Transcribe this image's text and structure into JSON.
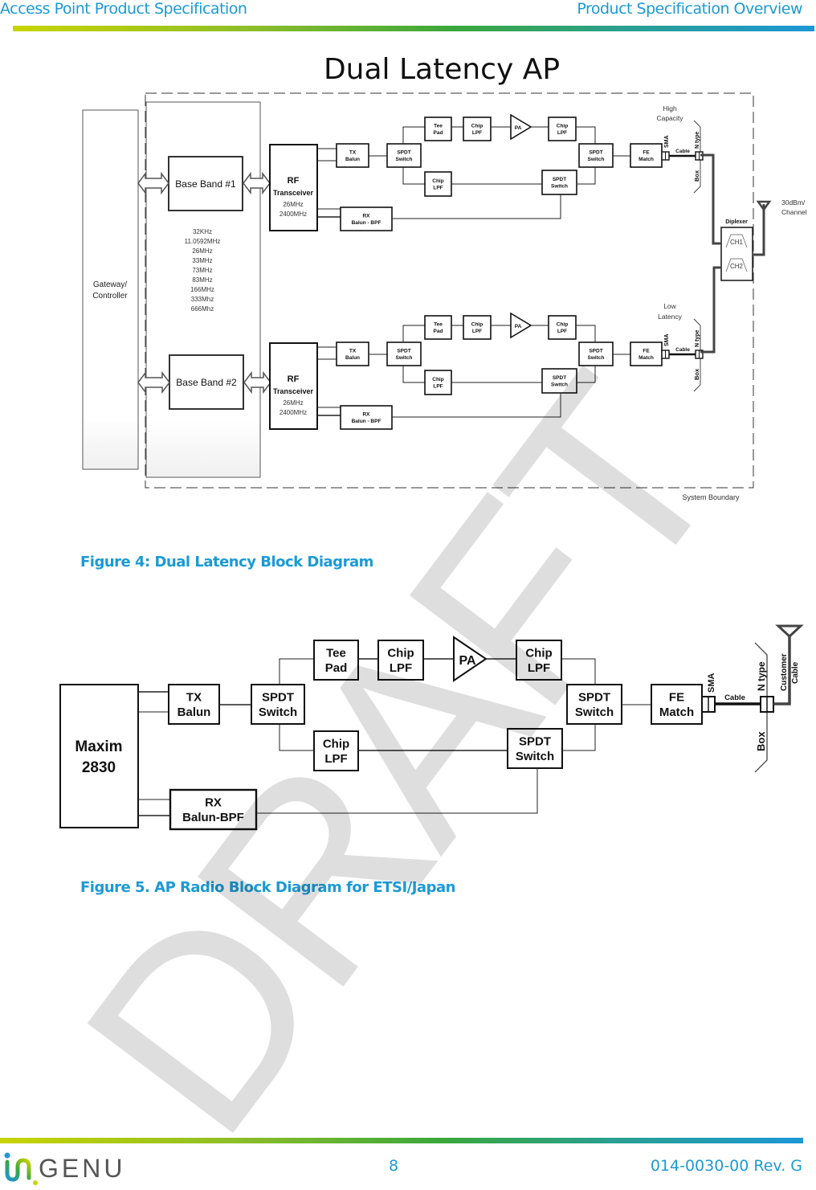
{
  "header": {
    "left_title": "Access Point Product Specification",
    "right_title": "Product Specification Overview",
    "colors": {
      "accent": "#1b9ad6",
      "rule_start": "#c8d400",
      "rule_end": "#1c97d6"
    }
  },
  "figure4": {
    "title": "Dual Latency AP",
    "caption": "Figure 4: Dual Latency Block Diagram",
    "gateway_label_line1": "Gateway/",
    "gateway_label_line2": "Controller",
    "baseband1": "Base Band #1",
    "baseband2": "Base Band #2",
    "clocks": [
      "32KHz",
      "11.0592MHz",
      "26MHz",
      "33MHz",
      "73MHz",
      "83MHz",
      "166MHz",
      "333Mhz",
      "666Mhz"
    ],
    "rf_title": "RF",
    "rf_subtitle": "Transceiver",
    "rf_freq1": "26MHz",
    "rf_freq2": "2400MHz",
    "tx_balun": [
      "TX",
      "Balun"
    ],
    "rx_balun": [
      "RX",
      "Balun -  BPF"
    ],
    "spdt": [
      "SPDT",
      "Switch"
    ],
    "tee_pad": [
      "Tee",
      "Pad"
    ],
    "chip_lpf": [
      "Chip",
      "LPF"
    ],
    "pa": "PA",
    "fe_match": [
      "FE",
      "Match"
    ],
    "sma": "SMA",
    "cable": "Cable",
    "ntype": "N type",
    "box": "Box",
    "path1_label": [
      "High",
      "Capacity"
    ],
    "path2_label": [
      "Low",
      "Latency"
    ],
    "diplexer": "Diplexer",
    "ch1": "CH1",
    "ch2": "CH2",
    "power_label": [
      "30dBm/",
      "Channel"
    ],
    "system_boundary": "System Boundary"
  },
  "figure5": {
    "caption": "Figure 5. AP Radio Block Diagram for ETSI/Japan",
    "maxim": [
      "Maxim",
      "2830"
    ],
    "tx_balun": [
      "TX",
      "Balun"
    ],
    "rx_balun": [
      "RX",
      "Balun-BPF"
    ],
    "spdt": [
      "SPDT",
      "Switch"
    ],
    "tee_pad": [
      "Tee",
      "Pad"
    ],
    "chip_lpf": [
      "Chip",
      "LPF"
    ],
    "pa": "PA",
    "fe_match": [
      "FE",
      "Match"
    ],
    "sma": "SMA",
    "cable": "Cable",
    "ntype": "N type",
    "box": "Box",
    "customer_cable": [
      "Customer",
      "Cable"
    ]
  },
  "watermark": "DRAFT",
  "footer": {
    "logo_text": "GENU",
    "page_number": "8",
    "doc_number": "014-0030-00 Rev. G"
  }
}
